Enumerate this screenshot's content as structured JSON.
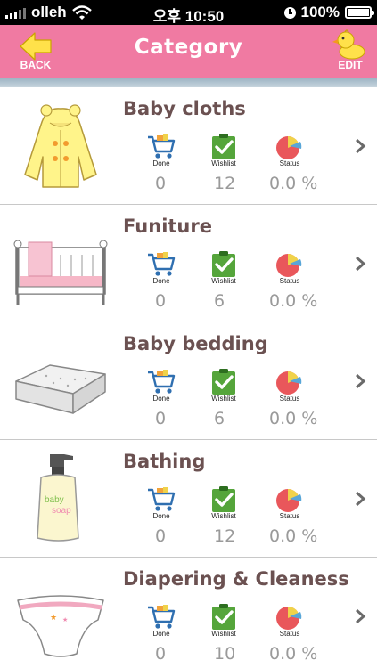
{
  "status_bar": {
    "carrier": "olleh",
    "time": "오후 10:50",
    "battery": "100%"
  },
  "nav": {
    "title": "Category",
    "back_label": "BACK",
    "edit_label": "EDIT"
  },
  "stat_labels": {
    "done": "Done",
    "wishlist": "Wishlist",
    "status": "Status"
  },
  "categories": [
    {
      "name": "Baby cloths",
      "done": "0",
      "wishlist": "12",
      "status": "0.0 %",
      "icon": "baby-raincoat"
    },
    {
      "name": "Funiture",
      "done": "0",
      "wishlist": "6",
      "status": "0.0 %",
      "icon": "crib"
    },
    {
      "name": "Baby bedding",
      "done": "0",
      "wishlist": "6",
      "status": "0.0 %",
      "icon": "mattress"
    },
    {
      "name": "Bathing",
      "done": "0",
      "wishlist": "12",
      "status": "0.0 %",
      "icon": "soap-bottle",
      "label_lines": [
        "baby",
        "soap"
      ]
    },
    {
      "name": "Diapering & Cleaness",
      "done": "0",
      "wishlist": "10",
      "status": "0.0 %",
      "icon": "diaper"
    }
  ],
  "colors": {
    "nav_pink": "#f07aa2",
    "title_brown": "#6b5151",
    "value_gray": "#9a9a9a"
  }
}
